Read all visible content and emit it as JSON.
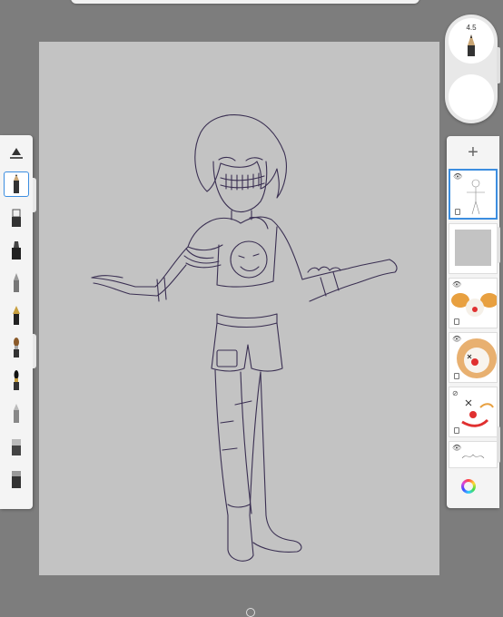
{
  "brush_puck": {
    "size_value": "4.5"
  },
  "toolbar": {
    "tools": [
      {
        "name": "ruler-tool",
        "icon": "ruler-icon"
      },
      {
        "name": "pencil-tool",
        "icon": "pencil-icon",
        "selected": true
      },
      {
        "name": "eraser-tool",
        "icon": "eraser-icon"
      },
      {
        "name": "marker-tool",
        "icon": "marker-icon"
      },
      {
        "name": "ballpoint-tool",
        "icon": "ballpoint-pen-icon"
      },
      {
        "name": "fountain-pen-tool",
        "icon": "fountain-pen-icon"
      },
      {
        "name": "paint-brush-tool",
        "icon": "paint-brush-icon"
      },
      {
        "name": "ink-brush-tool",
        "icon": "ink-brush-icon"
      },
      {
        "name": "airbrush-tool",
        "icon": "airbrush-icon"
      },
      {
        "name": "smudge-tool",
        "icon": "smudge-icon"
      },
      {
        "name": "fill-tool",
        "icon": "fill-icon"
      }
    ]
  },
  "layers_panel": {
    "add_icon": "+",
    "layers": [
      {
        "name": "sketch-layer",
        "visible": true,
        "selected": true
      },
      {
        "name": "gray-layer",
        "visible": true
      },
      {
        "name": "clown-wig-layer",
        "visible": true
      },
      {
        "name": "clown-face-layer",
        "visible": true
      },
      {
        "name": "clown-features-layer",
        "visible": false
      },
      {
        "name": "scribble-layer",
        "visible": true
      }
    ],
    "color_icon": "color-wheel-icon"
  },
  "colors": {
    "accent": "#3c8ee0",
    "canvas": "#c3c3c3",
    "ink": "#3a2f52"
  }
}
